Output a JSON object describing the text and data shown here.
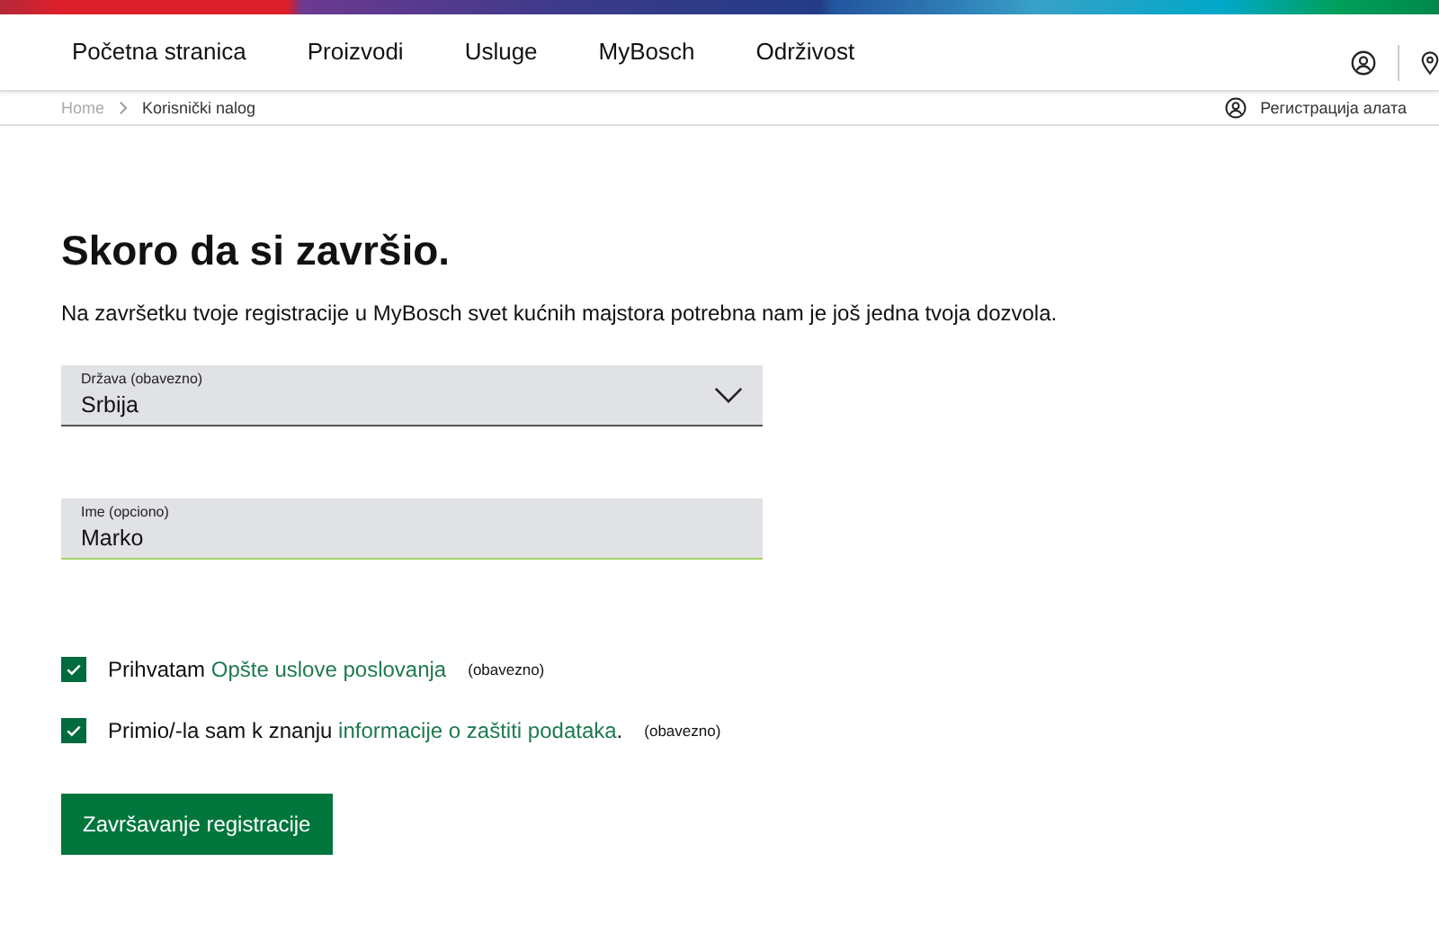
{
  "nav": {
    "items": [
      "Početna stranica",
      "Proizvodi",
      "Usluge",
      "MyBosch",
      "Održivost"
    ]
  },
  "breadcrumb": [
    "Home",
    "Korisnički nalog"
  ],
  "tool_registration": "Регистрација алата",
  "heading": "Skoro da si završio.",
  "intro": "Na završetku tvoje registracije u MyBosch svet kućnih majstora potrebna nam je još jedna tvoja dozvola.",
  "fields": [
    {
      "kind": "select",
      "label": "Država (obavezno)",
      "value": "Srbija"
    },
    {
      "kind": "text",
      "label": "Ime (opciono)",
      "value": "Marko"
    }
  ],
  "consents": [
    {
      "checked": true,
      "before": "Prihvatam ",
      "link": "Opšte uslove poslovanja",
      "note": "(obavezno)"
    },
    {
      "checked": true,
      "before": "Primio/-la sam k znanju ",
      "link": "informacije o zaštiti podataka",
      "after": ".",
      "note": "(obavezno)"
    }
  ],
  "submit": "Završavanje registracije"
}
